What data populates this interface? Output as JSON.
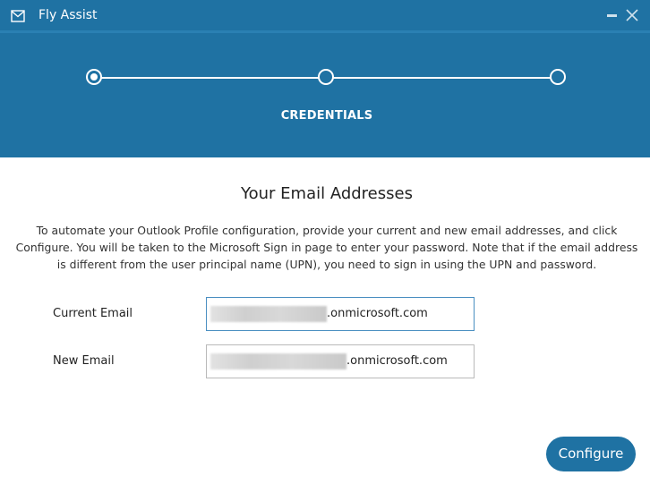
{
  "window": {
    "title": "Fly Assist"
  },
  "stepper": {
    "current_step_label": "CREDENTIALS",
    "steps_total": 3,
    "active_step": 1
  },
  "main": {
    "title": "Your Email Addresses",
    "description": "To automate your Outlook Profile configuration, provide your current and new email addresses, and click Configure. You will be taken to the Microsoft Sign in page to enter your password. Note that if the email address is different from the user principal name (UPN), you need to sign in using the UPN and password."
  },
  "form": {
    "current_email": {
      "label": "Current Email",
      "domain": ".onmicrosoft.com"
    },
    "new_email": {
      "label": "New Email",
      "domain": ".onmicrosoft.com"
    }
  },
  "actions": {
    "configure_label": "Configure"
  },
  "colors": {
    "accent": "#1f72a3",
    "header_text": "#ffffff"
  },
  "icons": {
    "app": "mail-icon",
    "minimize": "minimize-icon",
    "close": "close-icon"
  }
}
